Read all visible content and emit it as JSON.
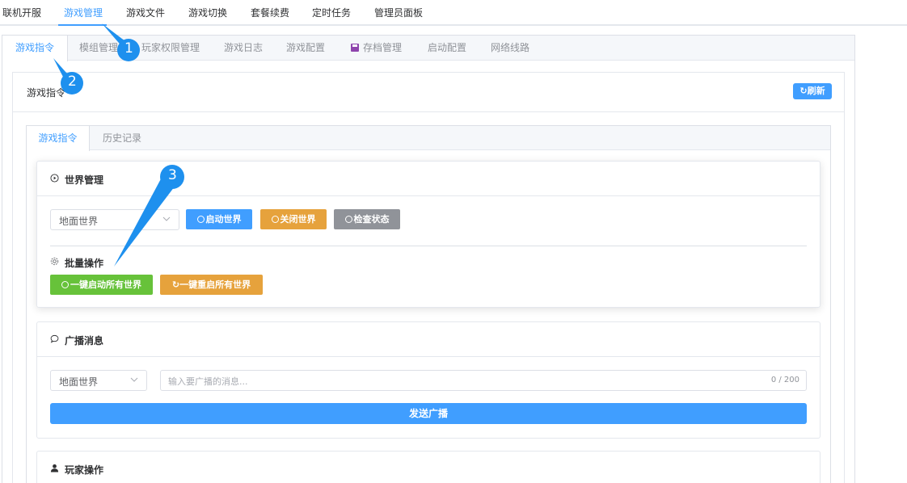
{
  "top_nav": {
    "items": [
      "联机开服",
      "游戏管理",
      "游戏文件",
      "游戏切换",
      "套餐续费",
      "定时任务",
      "管理员面板"
    ],
    "active_index": 1
  },
  "outer_tabs": {
    "items": [
      "游戏指令",
      "模组管理",
      "玩家权限管理",
      "游戏日志",
      "游戏配置",
      "存档管理",
      "启动配置",
      "网络线路"
    ],
    "active_index": 0
  },
  "command_panel": {
    "title": "游戏指令",
    "refresh_label": "刷新"
  },
  "inner_tabs": {
    "items": [
      "游戏指令",
      "历史记录"
    ],
    "active_index": 0
  },
  "world_management": {
    "title": "世界管理",
    "world_select": "地面世界",
    "start_label": "启动世界",
    "stop_label": "关闭世界",
    "check_label": "检查状态",
    "batch_title": "批量操作",
    "start_all_label": "一键启动所有世界",
    "restart_all_label": "一键重启所有世界"
  },
  "broadcast": {
    "title": "广播消息",
    "world_select": "地面世界",
    "placeholder": "输入要广播的消息...",
    "counter": "0 / 200",
    "send_label": "发送广播"
  },
  "player_ops": {
    "title": "玩家操作"
  },
  "callouts": [
    "1",
    "2",
    "3"
  ],
  "colors": {
    "primary": "#409eff",
    "warning": "#e6a23c",
    "info": "#909399",
    "success": "#67c23a",
    "callout": "#1e90ee"
  }
}
